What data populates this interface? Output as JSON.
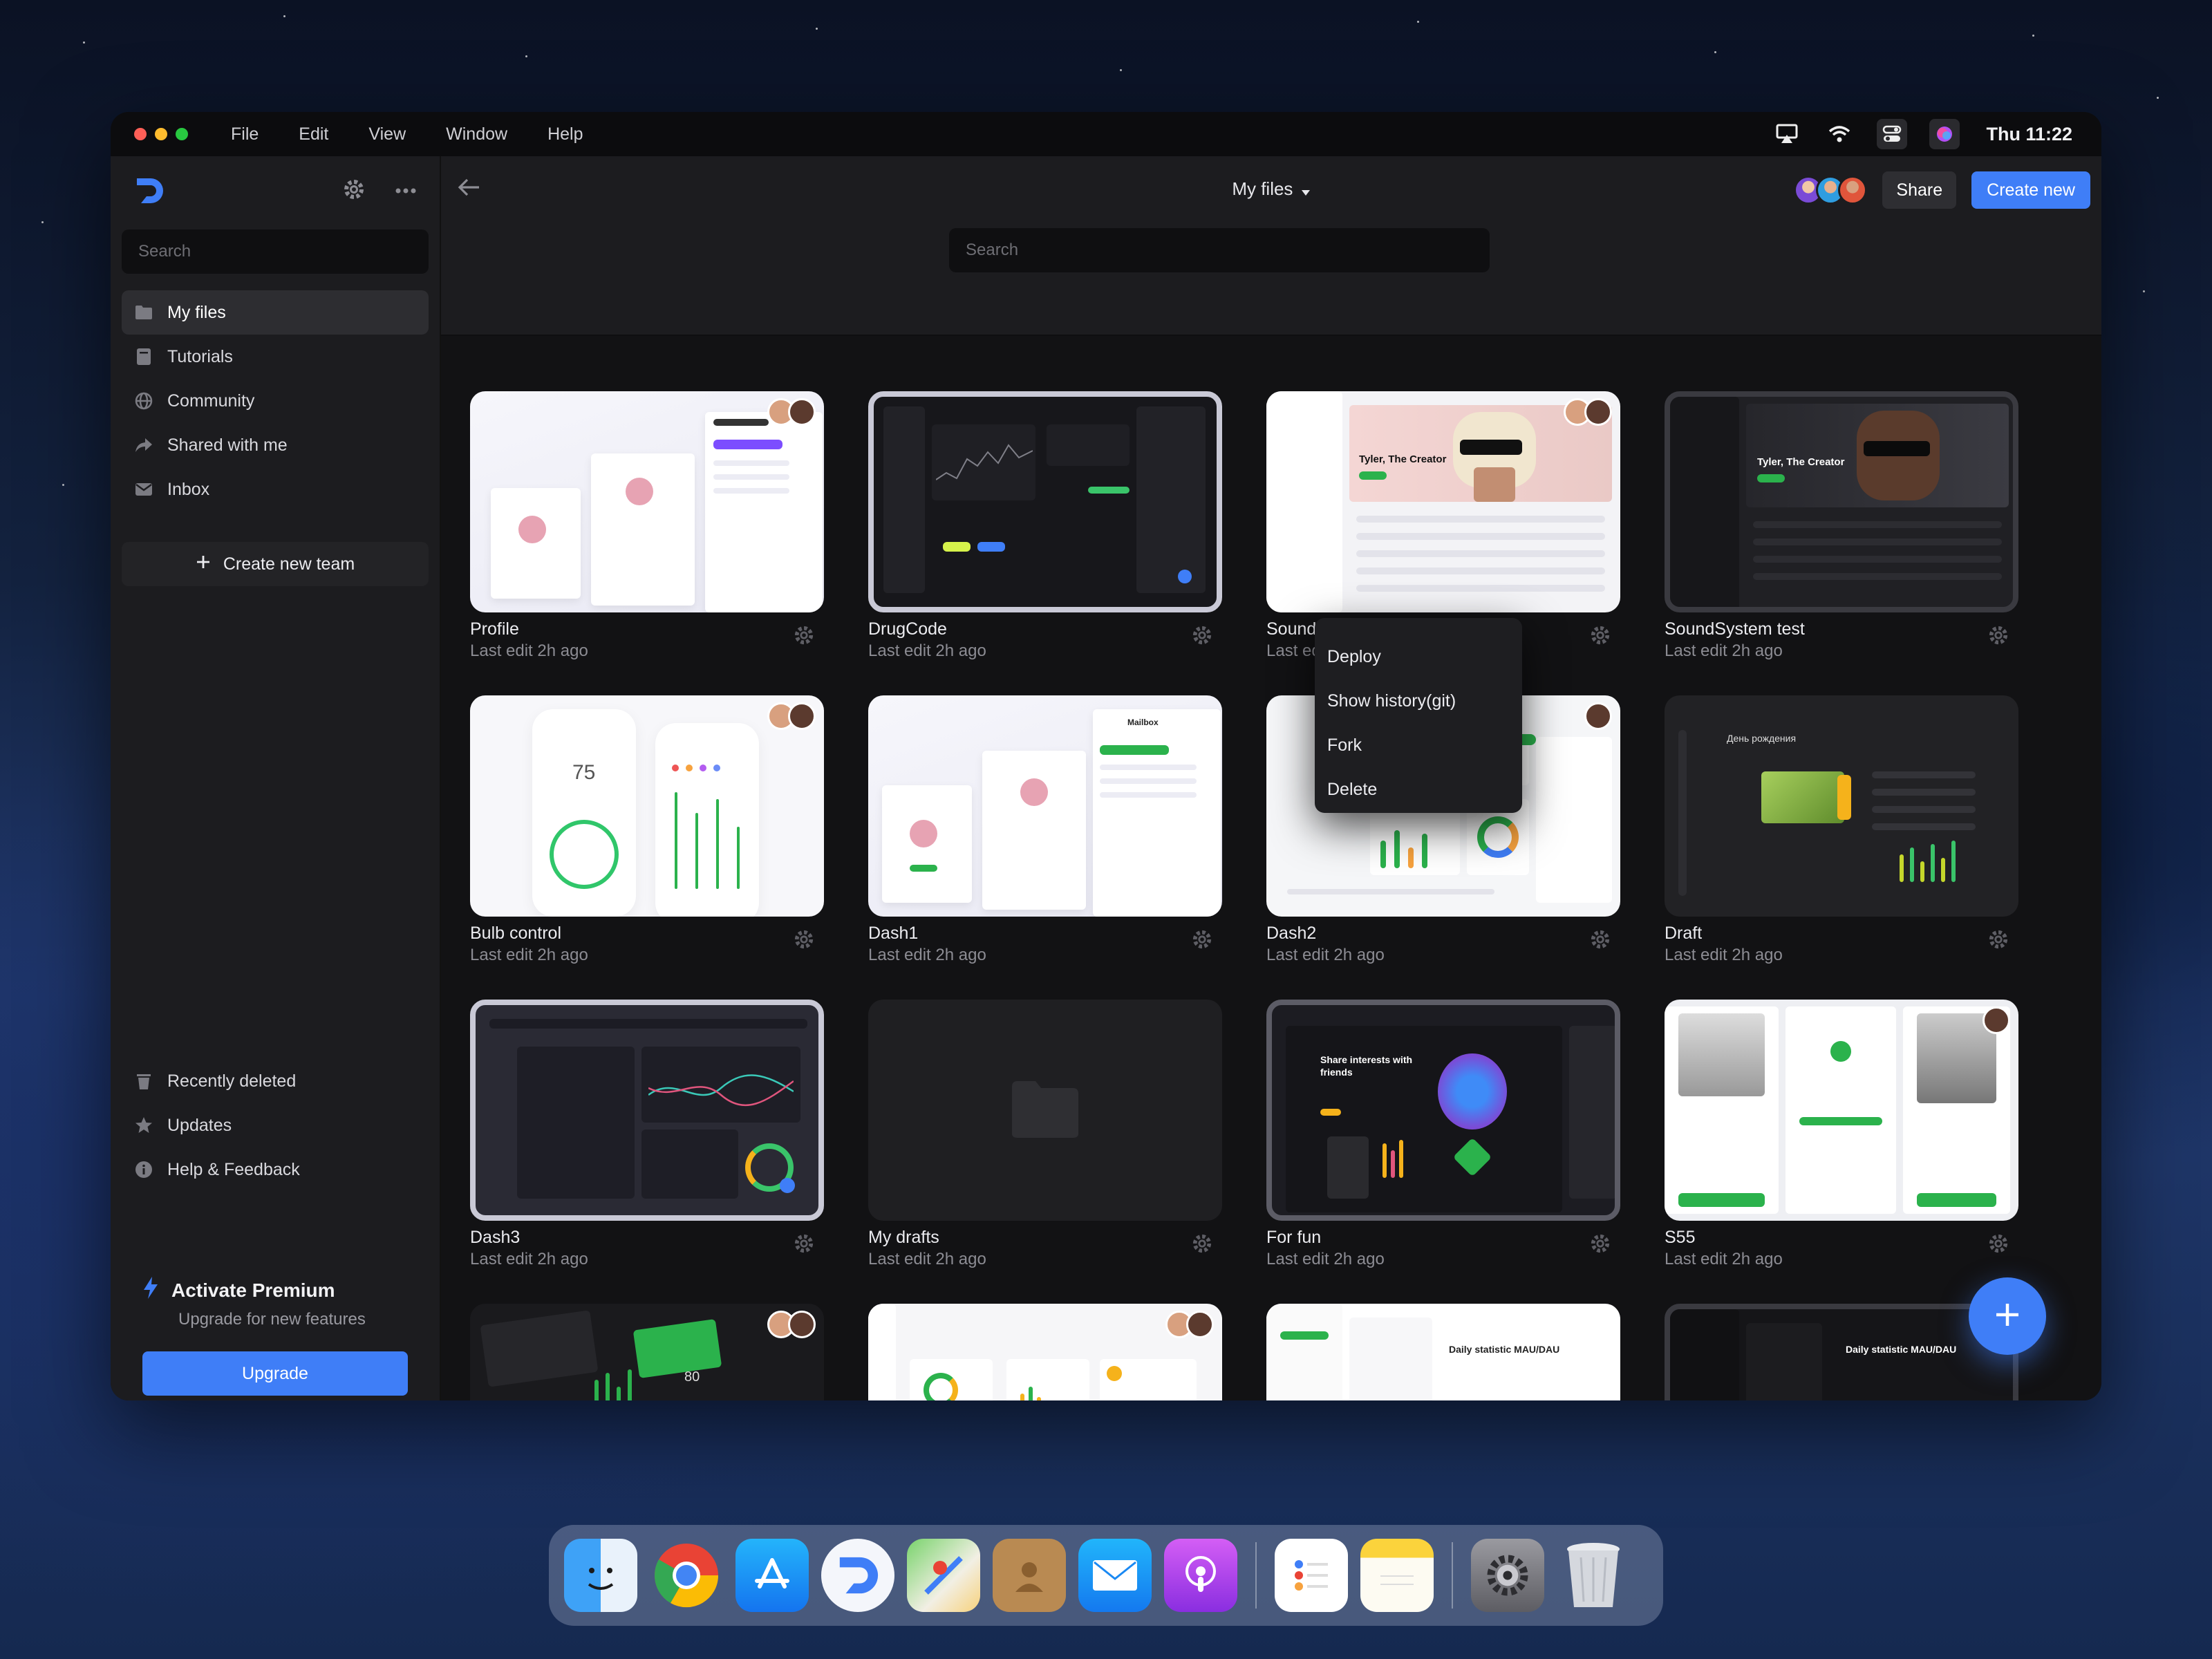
{
  "menubar": {
    "menus": [
      "File",
      "Edit",
      "View",
      "Window",
      "Help"
    ],
    "clock": "Thu 11:22",
    "icons": [
      "airplay-icon",
      "wifi-icon",
      "control-center-icon",
      "siri-icon"
    ]
  },
  "sidebar": {
    "search_placeholder": "Search",
    "items": [
      {
        "label": "My files",
        "icon": "folder-icon",
        "active": true
      },
      {
        "label": "Tutorials",
        "icon": "book-icon"
      },
      {
        "label": "Community",
        "icon": "globe-icon"
      },
      {
        "label": "Shared with me",
        "icon": "share-icon"
      },
      {
        "label": "Inbox",
        "icon": "inbox-icon"
      }
    ],
    "create_team": "Create new team",
    "bottom_items": [
      {
        "label": "Recently deleted",
        "icon": "trash-icon"
      },
      {
        "label": "Updates",
        "icon": "star-icon"
      },
      {
        "label": "Help & Feedback",
        "icon": "info-icon"
      }
    ],
    "premium": {
      "title": "Activate Premium",
      "subtitle": "Upgrade for new features",
      "button": "Upgrade"
    }
  },
  "header": {
    "title": "My files",
    "share": "Share",
    "create": "Create new",
    "search_placeholder": "Search"
  },
  "files": [
    {
      "name": "Profile",
      "meta": "Last edit 2h ago"
    },
    {
      "name": "DrugCode",
      "meta": "Last edit 2h ago"
    },
    {
      "name": "SoundSystem",
      "meta": "Last edit 2h ago"
    },
    {
      "name": "SoundSystem test",
      "meta": "Last edit 2h ago"
    },
    {
      "name": "Bulb control",
      "meta": "Last edit 2h ago"
    },
    {
      "name": "Dash1",
      "meta": "Last edit 2h ago"
    },
    {
      "name": "Dash2",
      "meta": "Last edit 2h ago"
    },
    {
      "name": "Draft",
      "meta": "Last edit 2h ago"
    },
    {
      "name": "Dash3",
      "meta": "Last edit 2h ago"
    },
    {
      "name": "My drafts",
      "meta": "Last edit 2h ago"
    },
    {
      "name": "For fun",
      "meta": "Last edit 2h ago"
    },
    {
      "name": "S55",
      "meta": "Last edit 2h ago"
    }
  ],
  "thumb_text": {
    "bulb_value": "75",
    "soundsystem_artist": "Tyler, The Creator",
    "mailbox": "Mailbox",
    "share_interests": "Share interests with friends",
    "daily_statistic": "Daily statistic MAU/DAU",
    "draft_heading": "День рождения",
    "dash_value": "80"
  },
  "context_menu": [
    "Deploy",
    "Show history(git)",
    "Fork",
    "Delete"
  ],
  "dock": [
    "finder-icon",
    "chrome-icon",
    "app-store-icon",
    "app-icon",
    "maps-icon",
    "contacts-icon",
    "mail-icon",
    "podcasts-icon",
    "reminders-icon",
    "notes-icon",
    "settings-icon",
    "trash-icon"
  ],
  "colors": {
    "accent": "#3f7ef7",
    "window_bg": "#131315",
    "sidebar_bg": "#1c1c1f"
  }
}
